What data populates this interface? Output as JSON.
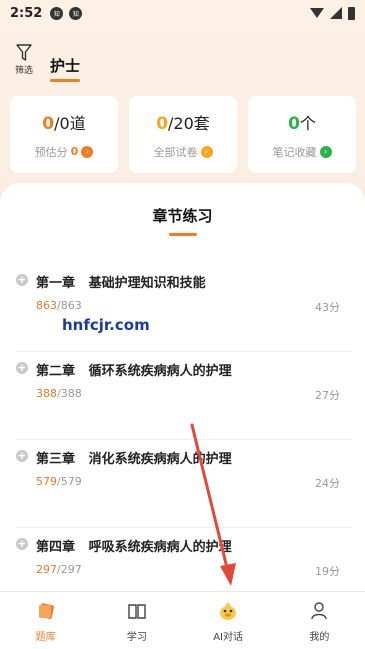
{
  "status_bar": {
    "time": "2:52",
    "notif_1": "知",
    "notif_2": "知"
  },
  "header": {
    "filter_label": "筛选",
    "subject": "护士"
  },
  "cards": [
    {
      "value": "0",
      "suffix": "/0道",
      "label": "预估分",
      "label_value": "0",
      "accent": "#f07d22"
    },
    {
      "value": "0",
      "suffix": "/20套",
      "label": "全部试卷",
      "accent": "#f5a623"
    },
    {
      "value": "0",
      "suffix": "个",
      "label": "笔记收藏",
      "accent": "#2bb24c"
    }
  ],
  "section_title": "章节练习",
  "chapters": [
    {
      "name": "第一章   基础护理知识和技能",
      "done": "863",
      "total": "/863",
      "score": "43分"
    },
    {
      "name": "第二章   循环系统疾病病人的护理",
      "done": "388",
      "total": "/388",
      "score": "27分"
    },
    {
      "name": "第三章   消化系统疾病病人的护理",
      "done": "579",
      "total": "/579",
      "score": "24分"
    },
    {
      "name": "第四章   呼吸系统疾病病人的护理",
      "done": "297",
      "total": "/297",
      "score": "19分"
    }
  ],
  "watermark": "hnfcjr.com",
  "tabs": [
    {
      "label": "题库",
      "icon": "question-bank-icon",
      "active": true
    },
    {
      "label": "学习",
      "icon": "book-icon",
      "active": false
    },
    {
      "label": "AI对话",
      "icon": "duck-mascot-icon",
      "active": false
    },
    {
      "label": "我的",
      "icon": "person-icon",
      "active": false
    }
  ],
  "colors": {
    "accent": "#f07d22",
    "bg_top": "#fdf1e6",
    "arrow": "#e04a3a"
  }
}
